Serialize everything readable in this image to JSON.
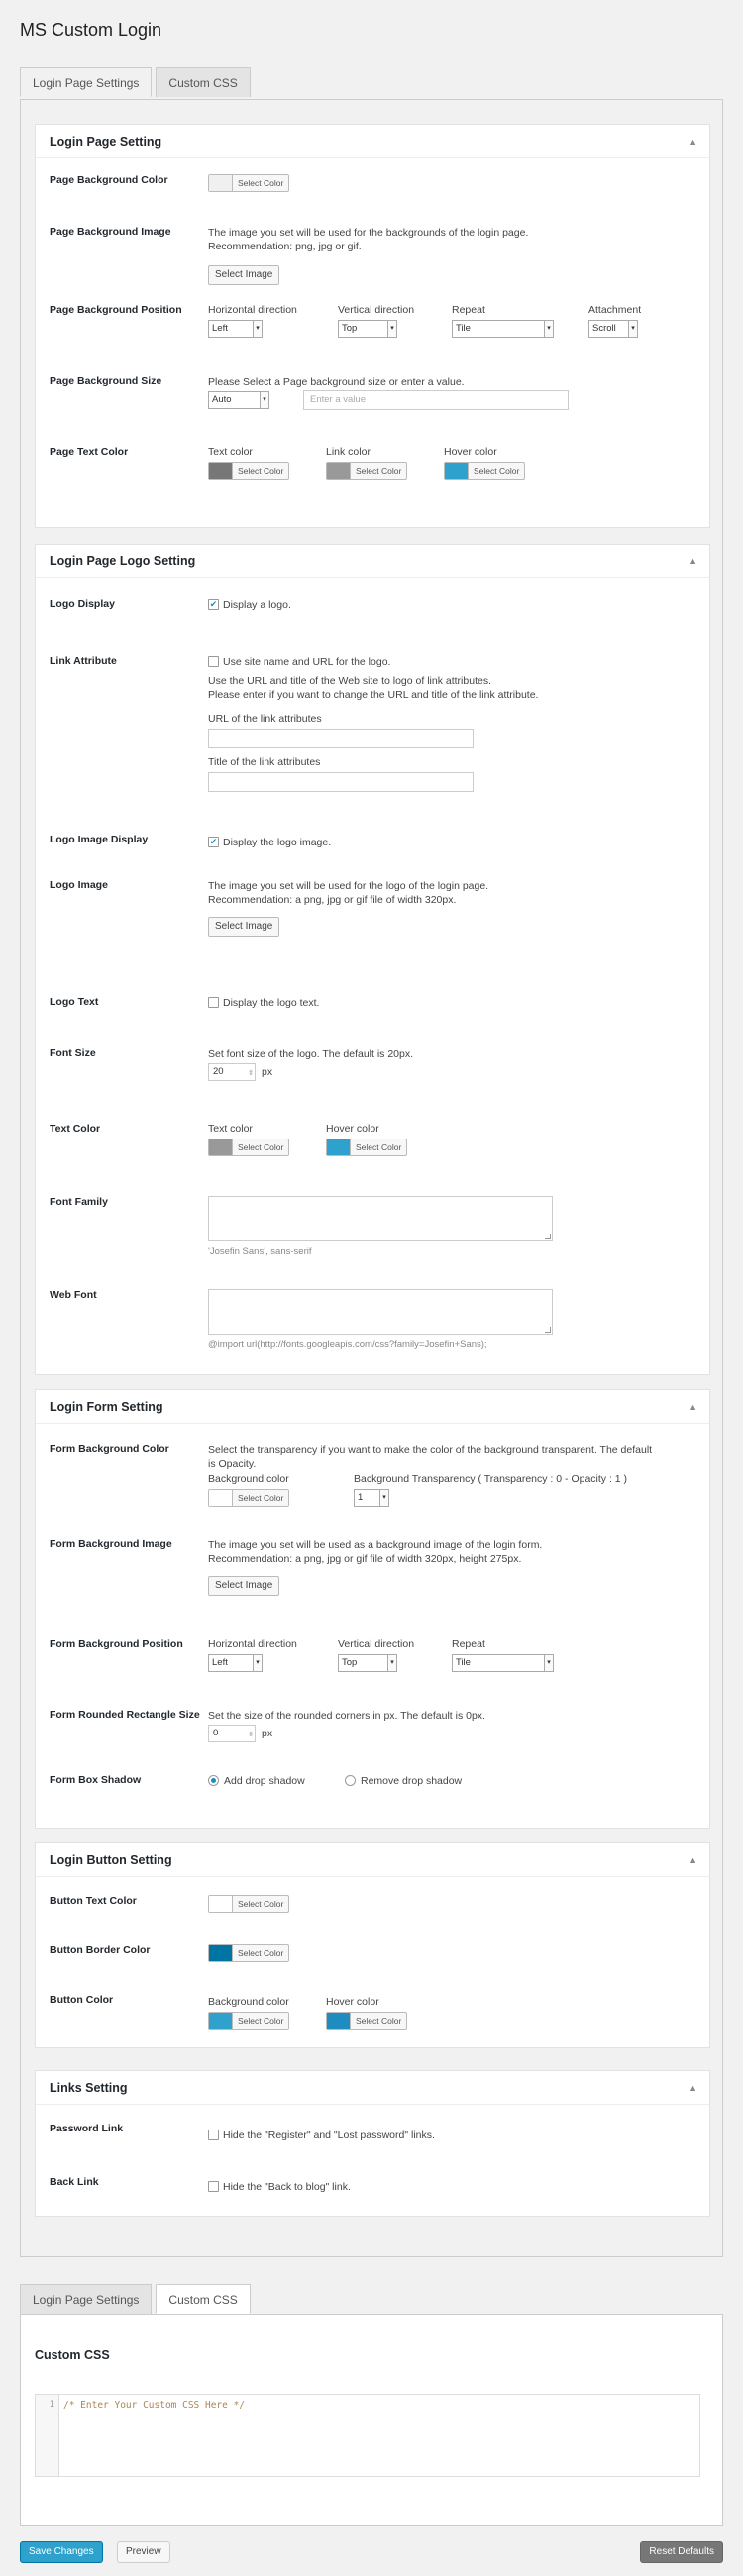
{
  "page_title": "MS Custom Login",
  "tabs": [
    "Login Page Settings",
    "Custom CSS"
  ],
  "sections": {
    "login_page": {
      "title": "Login Page Setting",
      "bg_color_label": "Page Background Color",
      "bg_image_label": "Page Background Image",
      "bg_image_desc1": "The image you set will be used for the backgrounds of the login page.",
      "bg_image_desc2": "Recommendation: png, jpg or gif.",
      "bg_position_label": "Page Background Position",
      "pos_h": "Horizontal direction",
      "pos_v": "Vertical direction",
      "repeat": "Repeat",
      "attachment": "Attachment",
      "pos_h_val": "Left",
      "pos_v_val": "Top",
      "repeat_val": "Tile",
      "attachment_val": "Scroll",
      "bg_size_label": "Page Background Size",
      "bg_size_desc": "Please Select a Page background size or enter a value.",
      "bg_size_val": "Auto",
      "bg_size_placeholder": "Enter a value",
      "text_color_label": "Page Text Color",
      "text_color": "Text color",
      "link_color": "Link color",
      "hover_color": "Hover color"
    },
    "logo": {
      "title": "Login Page Logo Setting",
      "display_label": "Logo Display",
      "display_cb": "Display a logo.",
      "link_attr_label": "Link Attribute",
      "link_attr_cb": "Use site name and URL for the logo.",
      "link_attr_desc1": "Use the URL and title of the Web site to logo of link attributes.",
      "link_attr_desc2": "Please enter if you want to change the URL and title of the link attribute.",
      "url_label": "URL of the link attributes",
      "title_label": "Title of the link attributes",
      "image_display_label": "Logo Image Display",
      "image_display_cb": "Display the logo image.",
      "image_label": "Logo Image",
      "image_desc1": "The image you set will be used for the logo of the login page.",
      "image_desc2": "Recommendation: a png, jpg or gif file of width 320px.",
      "text_label": "Logo Text",
      "text_cb": "Display the logo text.",
      "font_size_label": "Font Size",
      "font_size_desc": "Set font size of the logo. The default is 20px.",
      "font_size_val": "20",
      "px": "px",
      "text_color_label": "Text Color",
      "text_color": "Text color",
      "hover_color": "Hover color",
      "font_family_label": "Font Family",
      "font_family_hint": "'Josefin Sans', sans-serif",
      "web_font_label": "Web Font",
      "web_font_hint": "@import url(http://fonts.googleapis.com/css?family=Josefin+Sans);"
    },
    "form": {
      "title": "Login Form Setting",
      "bg_color_label": "Form Background Color",
      "bg_color_desc1": "Select the transparency if you want to make the color of the background transparent. The default",
      "bg_color_desc2": "is Opacity.",
      "bg_color": "Background color",
      "transparency": "Background Transparency ( Transparency : 0 - Opacity : 1 )",
      "transparency_val": "1",
      "bg_image_label": "Form Background Image",
      "bg_image_desc1": "The image you set will be used as a background image of the login form.",
      "bg_image_desc2": "Recommendation: a png, jpg or gif file of width 320px, height 275px.",
      "bg_position_label": "Form Background Position",
      "pos_h": "Horizontal direction",
      "pos_v": "Vertical direction",
      "repeat": "Repeat",
      "pos_h_val": "Left",
      "pos_v_val": "Top",
      "repeat_val": "Tile",
      "rounded_label": "Form Rounded Rectangle Size",
      "rounded_desc": "Set the size of the rounded corners in px. The default is 0px.",
      "rounded_val": "0",
      "px": "px",
      "shadow_label": "Form Box Shadow",
      "shadow_add": "Add drop shadow",
      "shadow_remove": "Remove drop shadow"
    },
    "button": {
      "title": "Login Button Setting",
      "text_color_label": "Button Text Color",
      "border_color_label": "Button Border Color",
      "color_label": "Button Color",
      "bg_color": "Background color",
      "hover_color": "Hover color"
    },
    "links": {
      "title": "Links Setting",
      "password_label": "Password Link",
      "password_cb": "Hide the \"Register\" and \"Lost password\" links.",
      "back_label": "Back Link",
      "back_cb": "Hide the \"Back to blog\" link."
    }
  },
  "common": {
    "select_color": "Select Color",
    "select_image": "Select Image",
    "toggle": "▲"
  },
  "custom_css": {
    "title": "Custom CSS",
    "line_no": "1",
    "code": "/* Enter Your Custom CSS Here */"
  },
  "actions": {
    "save": "Save Changes",
    "preview": "Preview",
    "reset": "Reset Defaults"
  },
  "colors": {
    "page_bg": "#f0f0f0",
    "text": "#777777",
    "link": "#999999",
    "hover": "#2ea2cc",
    "logo_text": "#999999",
    "logo_hover": "#2ea2cc",
    "form_bg": "#ffffff",
    "btn_text": "#ffffff",
    "btn_border": "#0074a2",
    "btn_bg": "#2ea2cc",
    "btn_hover": "#1e8cbe"
  }
}
